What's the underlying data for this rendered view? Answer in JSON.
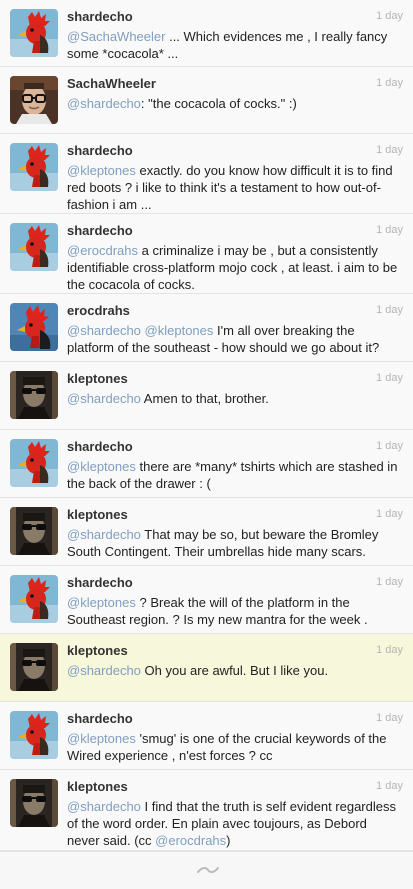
{
  "timeline": {
    "tweets": [
      {
        "author": "shardecho",
        "avatar": "rooster-avatar",
        "time": "1 day",
        "highlight": false,
        "segments": [
          {
            "t": "@SachaWheeler",
            "m": true
          },
          {
            "t": " ... Which evidences me , I really fancy some *cocacola* ...",
            "m": false
          }
        ]
      },
      {
        "author": "SachaWheeler",
        "avatar": "glasses-man-avatar",
        "time": "1 day",
        "highlight": false,
        "segments": [
          {
            "t": "@shardecho",
            "m": true
          },
          {
            "t": ": \"the cocacola of cocks.\" :)",
            "m": false
          }
        ]
      },
      {
        "author": "shardecho",
        "avatar": "rooster-avatar",
        "time": "1 day",
        "highlight": false,
        "segments": [
          {
            "t": "@kleptones",
            "m": true
          },
          {
            "t": "  exactly. do you know how difficult it is to find red boots ? i like to think it's a testament to how out-of-fashion i am ...",
            "m": false
          }
        ]
      },
      {
        "author": "shardecho",
        "avatar": "rooster-avatar",
        "time": "1 day",
        "highlight": false,
        "segments": [
          {
            "t": "@erocdrahs",
            "m": true
          },
          {
            "t": " a criminalize i may be , but a consistently identifiable cross-platform mojo cock , at least. i aim to be the cocacola of cocks.",
            "m": false
          }
        ]
      },
      {
        "author": "erocdrahs",
        "avatar": "rooster-blue-avatar",
        "time": "1 day",
        "highlight": false,
        "segments": [
          {
            "t": "@shardecho",
            "m": true
          },
          {
            "t": " ",
            "m": false
          },
          {
            "t": "@kleptones",
            "m": true
          },
          {
            "t": " I'm all over breaking the platform of the southeast - how should we go about it?",
            "m": false
          }
        ]
      },
      {
        "author": "kleptones",
        "avatar": "sunglasses-man-avatar",
        "time": "1 day",
        "highlight": false,
        "segments": [
          {
            "t": "@shardecho",
            "m": true
          },
          {
            "t": " Amen to that, brother.",
            "m": false
          }
        ]
      },
      {
        "author": "shardecho",
        "avatar": "rooster-avatar",
        "time": "1 day",
        "highlight": false,
        "segments": [
          {
            "t": "@kleptones",
            "m": true
          },
          {
            "t": " there are *many* tshirts which are stashed in the back of the drawer : (",
            "m": false
          }
        ]
      },
      {
        "author": "kleptones",
        "avatar": "sunglasses-man-avatar",
        "time": "1 day",
        "highlight": false,
        "segments": [
          {
            "t": "@shardecho",
            "m": true
          },
          {
            "t": " That may be so, but beware the Bromley South Contingent. Their umbrellas hide many scars.",
            "m": false
          }
        ]
      },
      {
        "author": "shardecho",
        "avatar": "rooster-avatar",
        "time": "1 day",
        "highlight": false,
        "segments": [
          {
            "t": "@kleptones",
            "m": true
          },
          {
            "t": " ? Break the will of the platform in the Southeast region. ? Is my new mantra for the week .",
            "m": false
          }
        ]
      },
      {
        "author": "kleptones",
        "avatar": "sunglasses-man-avatar",
        "time": "1 day",
        "highlight": true,
        "segments": [
          {
            "t": "@shardecho",
            "m": true
          },
          {
            "t": " Oh you are awful. But I like you.",
            "m": false
          }
        ]
      },
      {
        "author": "shardecho",
        "avatar": "rooster-avatar",
        "time": "1 day",
        "highlight": false,
        "segments": [
          {
            "t": "@kleptones",
            "m": true
          },
          {
            "t": " 'smug' is one of the crucial keywords of the Wired experience , n'est forces ? cc",
            "m": false
          }
        ]
      },
      {
        "author": "kleptones",
        "avatar": "sunglasses-man-avatar",
        "time": "1 day",
        "highlight": false,
        "segments": [
          {
            "t": "@shardecho",
            "m": true
          },
          {
            "t": " I find that the truth is self evident regardless of the word order. En plain avec toujours, as Debord never said. (cc ",
            "m": false
          },
          {
            "t": "@erocdrahs",
            "m": true
          },
          {
            "t": ")",
            "m": false
          }
        ]
      }
    ]
  },
  "footer": {
    "icon": "tilde-load-more-icon"
  },
  "colors": {
    "mention": "#7f9fc0",
    "highlight": "#f7f7dc",
    "time": "#b5b5b5"
  }
}
